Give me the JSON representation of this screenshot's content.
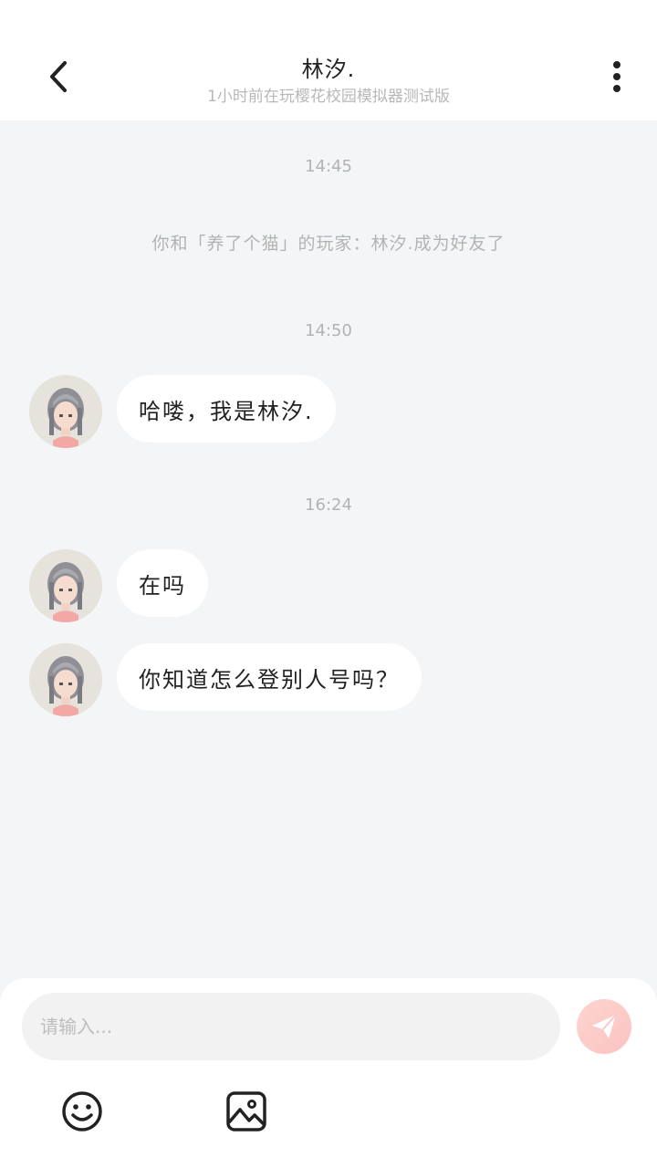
{
  "header": {
    "title": "林汐.",
    "subtitle": "1小时前在玩樱花校园模拟器测试版",
    "back_icon": "chevron-left-icon",
    "more_icon": "more-vertical-icon"
  },
  "messages": {
    "time_1": "14:45",
    "system_notice": "你和「养了个猫」的玩家：林汐.成为好友了",
    "time_2": "14:50",
    "msg_1": "哈喽，我是林汐.",
    "time_3": "16:24",
    "msg_2": "在吗",
    "msg_3": "你知道怎么登别人号吗？"
  },
  "composer": {
    "placeholder": "请输入...",
    "send_icon": "paper-plane-icon",
    "emoji_icon": "smiley-icon",
    "image_icon": "image-icon",
    "send_color": "#fbc8c6"
  }
}
